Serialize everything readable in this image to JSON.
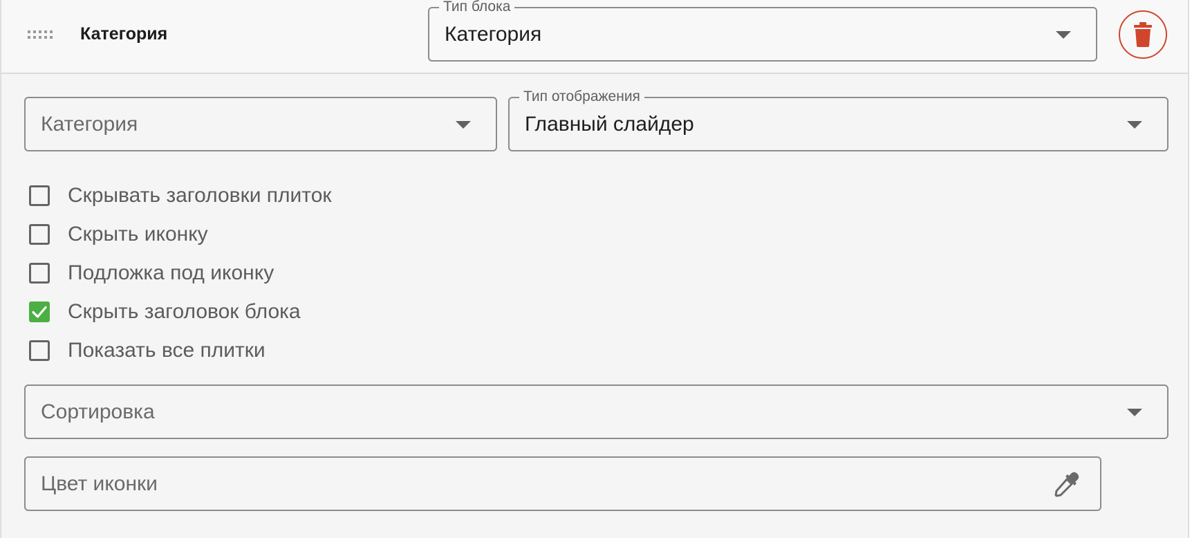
{
  "header": {
    "title": "Категория",
    "block_type": {
      "label": "Тип блока",
      "value": "Категория"
    },
    "delete_color": "#d0462d"
  },
  "fields": {
    "category": {
      "placeholder": "Категория"
    },
    "display_type": {
      "label": "Тип отображения",
      "value": "Главный слайдер"
    },
    "sorting": {
      "placeholder": "Сортировка"
    },
    "icon_color": {
      "placeholder": "Цвет иконки"
    }
  },
  "checkboxes": [
    {
      "label": "Скрывать заголовки плиток",
      "checked": false
    },
    {
      "label": "Скрыть иконку",
      "checked": false
    },
    {
      "label": "Подложка под иконку",
      "checked": false
    },
    {
      "label": "Скрыть заголовок блока",
      "checked": true
    },
    {
      "label": "Показать все плитки",
      "checked": false
    }
  ],
  "colors": {
    "checked": "#4caf43",
    "delete": "#d0462d"
  },
  "icons": {
    "drag": "drag-handle-icon",
    "delete": "trash-icon",
    "dropdown": "chevron-down-icon",
    "color_picker": "eyedropper-icon"
  }
}
